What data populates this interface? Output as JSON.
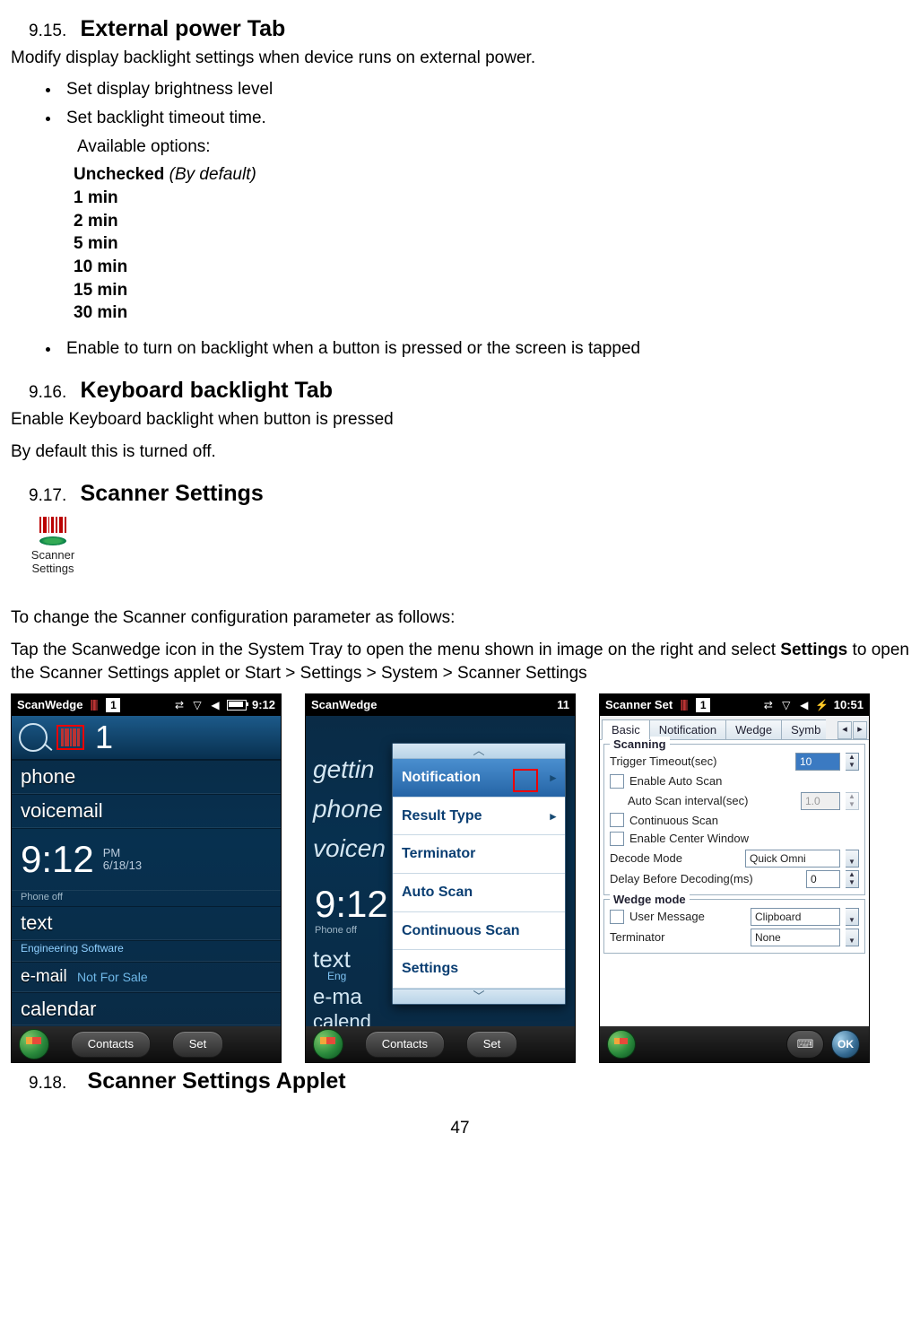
{
  "sections": {
    "s1": {
      "num": "9.15.",
      "title": "External power Tab"
    },
    "s2": {
      "num": "9.16.",
      "title": "Keyboard backlight Tab"
    },
    "s3": {
      "num": "9.17.",
      "title": "Scanner Settings"
    },
    "s4": {
      "num": "9.18.",
      "title": "Scanner Settings Applet"
    }
  },
  "extpower": {
    "intro": "Modify display backlight settings when device runs on external power.",
    "bullet1": "Set display brightness level",
    "bullet2": "Set backlight timeout time.",
    "avail_label": "Available options:",
    "opt_unchecked": "Unchecked",
    "opt_default": " (By default)",
    "opt_1": "1 min",
    "opt_2": "2 min",
    "opt_5": "5 min",
    "opt_10": "10 min",
    "opt_15": "15 min",
    "opt_30": "30 min",
    "bullet3": "Enable to turn on backlight when a button is pressed or the screen is tapped"
  },
  "keyboard": {
    "p1": "Enable Keyboard backlight when button is pressed",
    "p2": "By default this is turned off."
  },
  "scanner": {
    "icon_line1": "Scanner",
    "icon_line2": "Settings",
    "p1": "To change the Scanner configuration parameter as follows:",
    "p2_a": "Tap the Scanwedge icon in the System Tray to open the menu shown in image on the right and select ",
    "p2_bold": "Settings",
    "p2_b": " to open the Scanner Settings applet or Start > Settings > System > Scanner Settings"
  },
  "shot1": {
    "app": "ScanWedge",
    "clock": "9:12",
    "indicator": "1",
    "big_indicator": "1",
    "rows": {
      "phone": "phone",
      "voicemail": "voicemail",
      "clock": "9:12",
      "ampm": "PM",
      "date": "6/18/13",
      "phoneoff": "Phone off",
      "text": "text",
      "text_sub": "Engineering Software",
      "email": "e-mail",
      "email_sub": "Not For Sale",
      "calendar": "calendar"
    },
    "bottom": {
      "contacts": "Contacts",
      "set": "Set"
    }
  },
  "shot2": {
    "app": "ScanWedge",
    "clock": "11",
    "ghost": {
      "getting": "gettin",
      "phone": "phone",
      "voicemail": "voicen",
      "text": "text",
      "email": "e-ma",
      "calendar": "calend"
    },
    "time": "9:12",
    "phoneoff": "Phone off",
    "sub": "Eng",
    "popup": {
      "notification": "Notification",
      "result_type": "Result Type",
      "terminator": "Terminator",
      "auto_scan": "Auto Scan",
      "continuous": "Continuous Scan",
      "settings": "Settings"
    },
    "bottom": {
      "contacts": "Contacts",
      "set": "Set"
    }
  },
  "shot3": {
    "app": "Scanner Set",
    "clock": "10:51",
    "indicator": "1",
    "tabs": {
      "basic": "Basic",
      "notification": "Notification",
      "wedge": "Wedge",
      "symb": "Symb"
    },
    "chart_data": {
      "type": "table",
      "title": "Scanner Settings — Basic Tab",
      "sections": [
        {
          "name": "Scanning",
          "rows": [
            {
              "label": "Trigger Timeout(sec)",
              "value": "10",
              "control": "spinbox",
              "highlighted": true
            },
            {
              "label": "Enable Auto Scan",
              "value": false,
              "control": "checkbox"
            },
            {
              "label": "Auto Scan interval(sec)",
              "value": "1.0",
              "control": "spinbox",
              "enabled": false
            },
            {
              "label": "Continuous Scan",
              "value": false,
              "control": "checkbox"
            },
            {
              "label": "Enable Center Window",
              "value": false,
              "control": "checkbox"
            },
            {
              "label": "Decode Mode",
              "value": "Quick Omni",
              "control": "dropdown"
            },
            {
              "label": "Delay Before Decoding(ms)",
              "value": "0",
              "control": "spinbox"
            }
          ]
        },
        {
          "name": "Wedge mode",
          "rows": [
            {
              "label": "User Message",
              "value": false,
              "control": "checkbox"
            },
            {
              "label": "",
              "value": "Clipboard",
              "control": "dropdown"
            },
            {
              "label": "Terminator",
              "value": "None",
              "control": "dropdown"
            }
          ]
        }
      ]
    },
    "scanning": {
      "legend": "Scanning",
      "trigger": "Trigger Timeout(sec)",
      "trigger_val": "10",
      "enable_auto": "Enable Auto Scan",
      "auto_interval": "Auto Scan interval(sec)",
      "auto_interval_val": "1.0",
      "continuous": "Continuous Scan",
      "enable_center": "Enable Center Window",
      "decode_mode": "Decode Mode",
      "decode_mode_val": "Quick Omni",
      "delay": "Delay Before Decoding(ms)",
      "delay_val": "0"
    },
    "wedge": {
      "legend": "Wedge mode",
      "user_msg": "User Message",
      "user_msg_val": "Clipboard",
      "terminator": "Terminator",
      "terminator_val": "None"
    },
    "ok": "OK"
  },
  "page_number": "47"
}
